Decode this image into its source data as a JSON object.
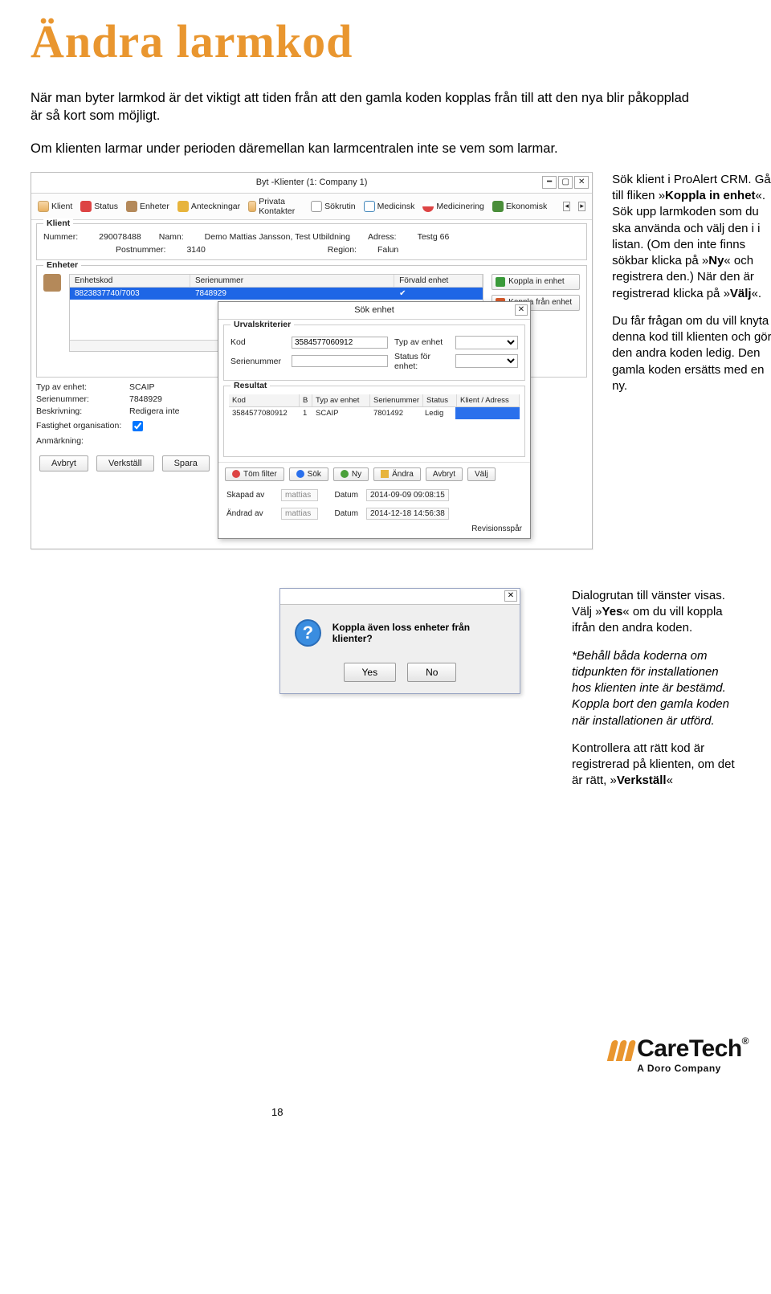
{
  "title": "Ändra larmkod",
  "intro": {
    "p1": "När man byter larmkod är det viktigt att tiden från att den gamla koden kopplas från till att den nya blir påkopplad är så kort som möjligt.",
    "p2": "Om klienten larmar under perioden däremellan kan larmcentralen inte se vem som larmar."
  },
  "right1": {
    "p1a": "Sök klient i ProAlert CRM. Gå till fliken »",
    "p1b": "Koppla in enhet",
    "p1c": "«. Sök upp larmkoden som du ska använda och välj den i i listan. (Om den inte finns sökbar klicka på »",
    "p1d": "Ny",
    "p1e": "« och registrera den.) När den är registrerad klicka på »",
    "p1f": "Välj",
    "p1g": "«.",
    "p2": "Du får frågan om du vill knyta denna kod till klienten och göra den andra koden ledig. Den gamla koden ersätts med en ny."
  },
  "right2": {
    "p1a": "Dialogrutan till vänster  visas. Välj »",
    "p1b": "Yes",
    "p1c": "« om du vill koppla ifrån den andra koden.",
    "p2": "*Behåll båda koderna om tidpunkten för installationen hos klienten inte är bestämd. Koppla bort den gamla koden när installationen är utförd.",
    "p3a": "Kontrollera att rätt kod är registrerad på klienten, om det är rätt, »",
    "p3b": "Verkställ",
    "p3c": "«"
  },
  "shot1": {
    "title": "Byt -Klienter (1: Company 1)",
    "tabs": {
      "klient": "Klient",
      "status": "Status",
      "enheter": "Enheter",
      "anteckningar": "Anteckningar",
      "privata": "Privata Kontakter",
      "sokrutin": "Sökrutin",
      "medicinsk": "Medicinsk",
      "medicinering": "Medicinering",
      "ekonomisk": "Ekonomisk"
    },
    "klient": {
      "legend": "Klient",
      "nummer_l": "Nummer:",
      "nummer_v": "290078488",
      "namn_l": "Namn:",
      "namn_v": "Demo Mattias Jansson, Test Utbildning",
      "adress_l": "Adress:",
      "adress_v": "Testg 66",
      "postnummer_l": "Postnummer:",
      "postnummer_v": "3140",
      "region_l": "Region:",
      "region_v": "Falun"
    },
    "enheter": {
      "legend": "Enheter",
      "grid": {
        "h1": "Enhetskod",
        "h2": "Serienummer",
        "h3": "Förvald enhet",
        "r1c1": "8823837740/7003",
        "r1c2": "7848929",
        "r1c3": "✔"
      },
      "btn_in": "Koppla in enhet",
      "btn_fr": "Koppla från enhet"
    },
    "details": {
      "typ_l": "Typ av enhet:",
      "typ_v": "SCAIP",
      "serie_l": "Serienummer:",
      "serie_v": "7848929",
      "besk_l": "Beskrivning:",
      "besk_v": "Redigera inte",
      "fast_l": "Fastighet organisation:",
      "anm_l": "Anmärkning:"
    },
    "bottom": {
      "avbryt": "Avbryt",
      "verkstall": "Verkställ",
      "spara": "Spara"
    },
    "modal": {
      "title": "Sök enhet",
      "urv_legend": "Urvalskriterier",
      "kod_l": "Kod",
      "kod_v": "3584577060912",
      "ser_l": "Serienummer",
      "typ_l": "Typ av enhet",
      "stat_l": "Status för enhet:",
      "res_legend": "Resultat",
      "rh_kod": "Kod",
      "rh_b": "B",
      "rh_typ": "Typ av enhet",
      "rh_ser": "Serienummer",
      "rh_status": "Status",
      "rh_klient": "Klient / Adress",
      "rr_kod": "3584577080912",
      "rr_b": "1",
      "rr_typ": "SCAIP",
      "rr_ser": "7801492",
      "rr_status": "Ledig",
      "btns": {
        "tom": "Töm filter",
        "sok": "Sök",
        "ny": "Ny",
        "andra": "Ändra",
        "avbryt": "Avbryt",
        "valj": "Välj"
      },
      "skapad_l": "Skapad av",
      "skapad_v": "mattias",
      "datum_l": "Datum",
      "sk_datum": "2014-09-09 09:08:15",
      "andrad_l": "Ändrad av",
      "andrad_v": "mattias",
      "an_datum": "2014-12-18 14:56:38",
      "rev": "Revisionsspår"
    }
  },
  "dlg": {
    "text": "Koppla även loss enheter från klienter?",
    "yes": "Yes",
    "no": "No"
  },
  "footer": {
    "brand_prefix": "((( ",
    "brand": "CareTech",
    "reg": "®",
    "sub": "A Doro Company"
  },
  "pagenum": "18"
}
